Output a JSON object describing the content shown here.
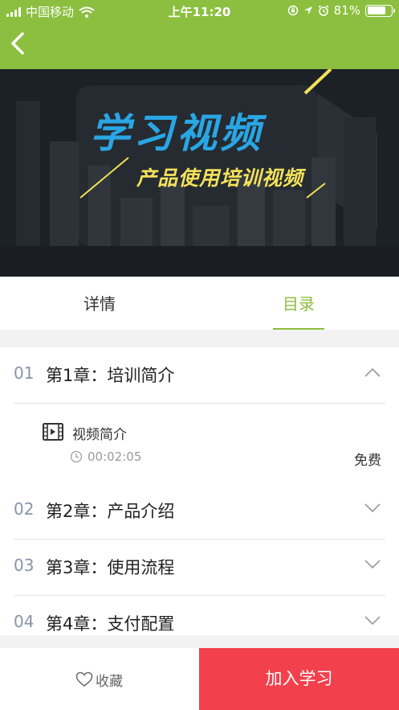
{
  "status_bar": {
    "carrier": "中国移动",
    "time": "上午11:20",
    "battery_text": "81%",
    "battery_level": 0.81,
    "icons": [
      "signal-icon",
      "wifi-icon",
      "rotation-lock-icon",
      "location-icon",
      "alarm-icon",
      "battery-icon"
    ]
  },
  "nav": {
    "back_icon": "chevron-left-icon",
    "color": "#8cbf3f"
  },
  "banner": {
    "title": "学习视频",
    "subtitle": "产品使用培训视频"
  },
  "tabs": [
    {
      "label": "详情",
      "active": false
    },
    {
      "label": "目录",
      "active": true
    }
  ],
  "chapters": [
    {
      "num": "01",
      "title": "第1章：培训简介",
      "expanded": true,
      "lessons": [
        {
          "name": "视频简介",
          "duration": "00:02:05",
          "price": "免费"
        }
      ]
    },
    {
      "num": "02",
      "title": "第2章：产品介绍",
      "expanded": false
    },
    {
      "num": "03",
      "title": "第3章：使用流程",
      "expanded": false
    },
    {
      "num": "04",
      "title": "第4章：支付配置",
      "expanded": false
    }
  ],
  "bottom": {
    "favorite_label": "收藏",
    "join_label": "加入学习",
    "join_color": "#f2404c"
  }
}
